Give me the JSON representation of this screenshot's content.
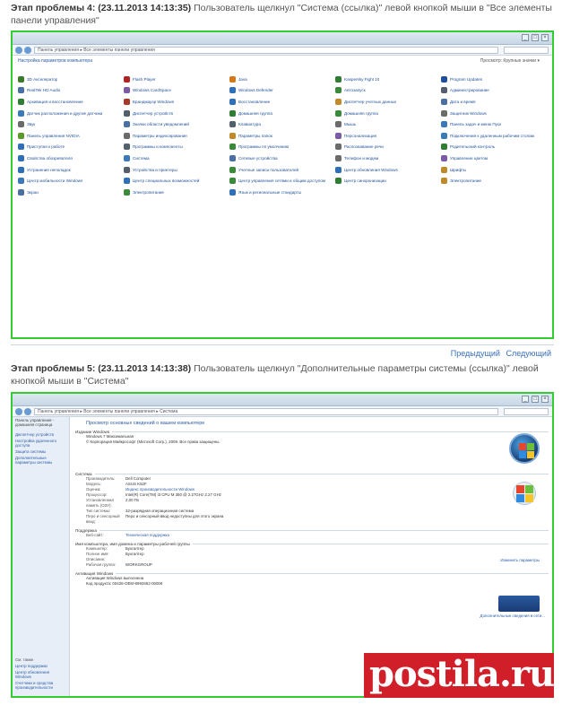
{
  "step4": {
    "label": "Этап проблемы 4:",
    "time": "(23.11.2013 14:13:35)",
    "text": "Пользователь щелкнул \"Система (ссылка)\" левой кнопкой мыши в \"Все элементы панели управления\""
  },
  "step5": {
    "label": "Этап проблемы 5:",
    "time": "(23.11.2013 14:13:38)",
    "text": "Пользователь щелкнул \"Дополнительные параметры системы (ссылка)\" левой кнопкой мыши в \"Система\""
  },
  "nav_links": {
    "previous": "Предыдущий",
    "next": "Следующий"
  },
  "control_panel": {
    "address": "Панель управления ▸ Все элементы панели управления",
    "title": "Настройка параметров компьютера",
    "view": "Просмотр: Крупные значки ▾",
    "items": [
      {
        "label": "3D Акселератор",
        "color": "#3b7a2a"
      },
      {
        "label": "Flash Player",
        "color": "#b22222"
      },
      {
        "label": "Java",
        "color": "#d27a1a"
      },
      {
        "label": "Kaspersky Fight 10",
        "color": "#2e7d32"
      },
      {
        "label": "Program Updates",
        "color": "#1f4f9a"
      },
      {
        "label": "RealTek HD Audio",
        "color": "#4a6fa5"
      },
      {
        "label": "Windows CardSpace",
        "color": "#7b5aa6"
      },
      {
        "label": "Windows Defender",
        "color": "#2f6fb7"
      },
      {
        "label": "Автозапуск",
        "color": "#3a8a3a"
      },
      {
        "label": "Администрирование",
        "color": "#555f6b"
      },
      {
        "label": "Архивация и восстановление",
        "color": "#2e7d32"
      },
      {
        "label": "Брандмауэр Windows",
        "color": "#a33a2a"
      },
      {
        "label": "Восстановление",
        "color": "#2f6fb7"
      },
      {
        "label": "Диспетчер учетных данных",
        "color": "#c08a2a"
      },
      {
        "label": "Дата и время",
        "color": "#4a6fa5"
      },
      {
        "label": "Датчик расположения и другие датчики",
        "color": "#3a7ab8"
      },
      {
        "label": "Диспетчер устройств",
        "color": "#555f6b"
      },
      {
        "label": "Домашняя группа",
        "color": "#2e7d32"
      },
      {
        "label": "Домашняя группа",
        "color": "#3a8a3a"
      },
      {
        "label": "Защитник Windows",
        "color": "#6b6b6b"
      },
      {
        "label": "Звук",
        "color": "#6b6b6b"
      },
      {
        "label": "Значки области уведомлений",
        "color": "#4a6fa5"
      },
      {
        "label": "Клавиатура",
        "color": "#555f6b"
      },
      {
        "label": "Мышь",
        "color": "#6b6b6b"
      },
      {
        "label": "Панель задач и меню Пуск",
        "color": "#3a7ab8"
      },
      {
        "label": "Панель управления NVIDIA",
        "color": "#5a9a2a"
      },
      {
        "label": "Параметры индексирования",
        "color": "#6b6b6b"
      },
      {
        "label": "Параметры папок",
        "color": "#c08a2a"
      },
      {
        "label": "Персонализация",
        "color": "#7b5aa6"
      },
      {
        "label": "Подключения к удаленным рабочим столам",
        "color": "#3a7ab8"
      },
      {
        "label": "Приступая к работе",
        "color": "#2f6fb7"
      },
      {
        "label": "Программы и компоненты",
        "color": "#555f6b"
      },
      {
        "label": "Программы по умолчанию",
        "color": "#3a8a3a"
      },
      {
        "label": "Распознавание речи",
        "color": "#6b6b6b"
      },
      {
        "label": "Родительский контроль",
        "color": "#2e7d32"
      },
      {
        "label": "Свойства обозревателя",
        "color": "#2f6fb7"
      },
      {
        "label": "Система",
        "color": "#3a7ab8"
      },
      {
        "label": "Сетевые устройства",
        "color": "#4a6fa5"
      },
      {
        "label": "Телефон и модем",
        "color": "#6b6b6b"
      },
      {
        "label": "Управление цветом",
        "color": "#7b5aa6"
      },
      {
        "label": "Устранение неполадок",
        "color": "#2f6fb7"
      },
      {
        "label": "Устройства и принтеры",
        "color": "#555f6b"
      },
      {
        "label": "Учетные записи пользователей",
        "color": "#3a8a3a"
      },
      {
        "label": "Центр обновления Windows",
        "color": "#2f6fb7"
      },
      {
        "label": "Шрифты",
        "color": "#c08a2a"
      },
      {
        "label": "Центр мобильности Windows",
        "color": "#3a7ab8"
      },
      {
        "label": "Центр специальных возможностей",
        "color": "#2f6fb7"
      },
      {
        "label": "Центр управления сетями и общим доступом",
        "color": "#3a8a3a"
      },
      {
        "label": "Центр синхронизации",
        "color": "#2e7d32"
      },
      {
        "label": "Электропитание",
        "color": "#c08a2a"
      },
      {
        "label": "Экран",
        "color": "#4a6fa5"
      },
      {
        "label": "Электропитание",
        "color": "#3a8a3a"
      },
      {
        "label": "Язык и региональные стандарты",
        "color": "#2f6fb7"
      }
    ]
  },
  "system_page": {
    "address": "Панель управления ▸ Все элементы панели управления ▸ Система",
    "title": "Просмотр основных сведений о вашем компьютере",
    "sidebar": {
      "head": "Панель управления - домашняя страница",
      "items": [
        "Диспетчер устройств",
        "Настройка удаленного доступа",
        "Защита системы",
        "Дополнительные параметры системы"
      ],
      "see_also": "См. также",
      "bottom_items": [
        "Центр поддержки",
        "Центр обновления Windows",
        "Счетчики и средства производительности"
      ]
    },
    "edition_head": "Издание Windows",
    "edition": "Windows 7 Максимальная",
    "copyright": "© Корпорация Майкрософт (Microsoft Corp.), 2009. Все права защищены.",
    "system_head": "Система",
    "system_rows": [
      {
        "k": "Производитель:",
        "v": "Dell Computer"
      },
      {
        "k": "Модель:",
        "v": "ASUS K52F"
      },
      {
        "k": "Оценка:",
        "v": "Индекс производительности Windows"
      },
      {
        "k": "Процессор:",
        "v": "Intel(R) Core(TM) i3 CPU M 350 @ 2.27GHz 2.27 GHz"
      },
      {
        "k": "Установленная память (ОЗУ):",
        "v": "2,00 ГБ"
      },
      {
        "k": "Тип системы:",
        "v": "32-разрядная операционная система"
      },
      {
        "k": "Перо и сенсорный ввод:",
        "v": "Перо и сенсорный ввод недоступны для этого экрана"
      }
    ],
    "support_head": "Поддержка",
    "support_rows": [
      {
        "k": "Веб-сайт:",
        "v": "Техническая поддержка"
      }
    ],
    "name_head": "Имя компьютера, имя домена и параметры рабочей группы",
    "name_rows": [
      {
        "k": "Компьютер:",
        "v": "Бухгалтер"
      },
      {
        "k": "Полное имя:",
        "v": "Бухгалтер"
      },
      {
        "k": "Описание:",
        "v": ""
      },
      {
        "k": "Рабочая группа:",
        "v": "WORKGROUP"
      }
    ],
    "change_link": "Изменить параметры",
    "activation_head": "Активация Windows",
    "activation_text": "Активация Windows выполнена",
    "product_code": "Код продукта: 00426-OEM-8992662-00006",
    "genuine_link": "Дополнительные сведения в сети..."
  },
  "watermark": "postila.ru"
}
